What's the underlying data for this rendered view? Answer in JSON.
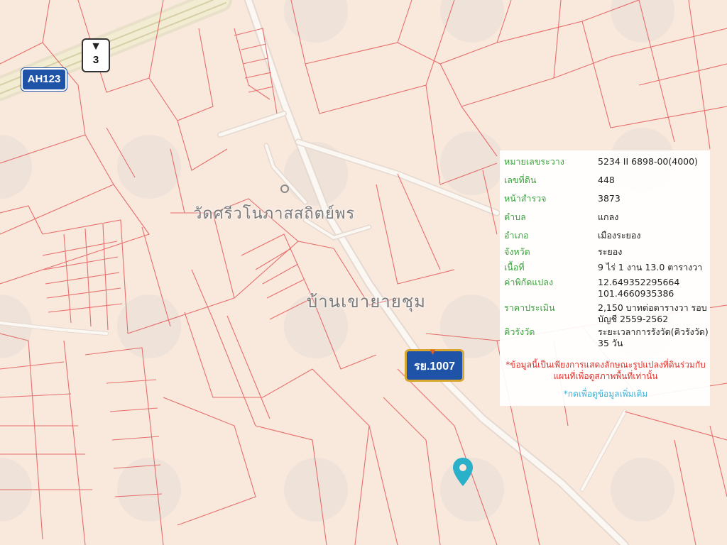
{
  "map": {
    "place_labels": {
      "temple": "วัดศรีวโนภาสสถิตย์พร",
      "village": "บ้านเขายายชุม"
    },
    "route_shields": {
      "asian_highway": "AH123",
      "national_highway": "3",
      "rural_road": "รย.1007"
    },
    "colors": {
      "background": "#f9e8dc",
      "parcel_line": "#e35a5a",
      "road": "#fbf7f3",
      "pin": "#2ab0c8",
      "label_green": "#3aa23c",
      "notice_red": "#e0302a",
      "link_blue": "#3bb0d9",
      "shield_blue": "#1f53a8"
    }
  },
  "parcel_info": {
    "rows": [
      {
        "label": "หมายเลขระวาง",
        "value": "5234 II 6898-00(4000)"
      },
      {
        "label": "เลขที่ดิน",
        "value": "448"
      },
      {
        "label": "หน้าสำรวจ",
        "value": "3873"
      },
      {
        "label": "ตำบล",
        "value": "แกลง"
      },
      {
        "label": "อำเภอ",
        "value": "เมืองระยอง"
      },
      {
        "label": "จังหวัด",
        "value": "ระยอง"
      },
      {
        "label": "เนื้อที่",
        "value": "9 ไร่ 1 งาน 13.0 ตารางวา"
      },
      {
        "label": "ค่าพิกัดแปลง",
        "value": "12.649352295664 101.4660935386"
      },
      {
        "label": "ราคาประเมิน",
        "value": "2,150 บาทต่อตารางวา รอบบัญชี 2559-2562"
      },
      {
        "label": "คิวรังวัด",
        "value": "ระยะเวลาการรังวัด(คิวรังวัด) 35 วัน"
      }
    ],
    "notice": "*ข้อมูลนี้เป็นเพียงการแสดงลักษณะรูปแปลงที่ดินร่วมกับแผนที่เพื่อดูสภาพพื้นที่เท่านั้น",
    "more_link": "*กดเพื่อดูข้อมูลเพิ่มเติม"
  }
}
